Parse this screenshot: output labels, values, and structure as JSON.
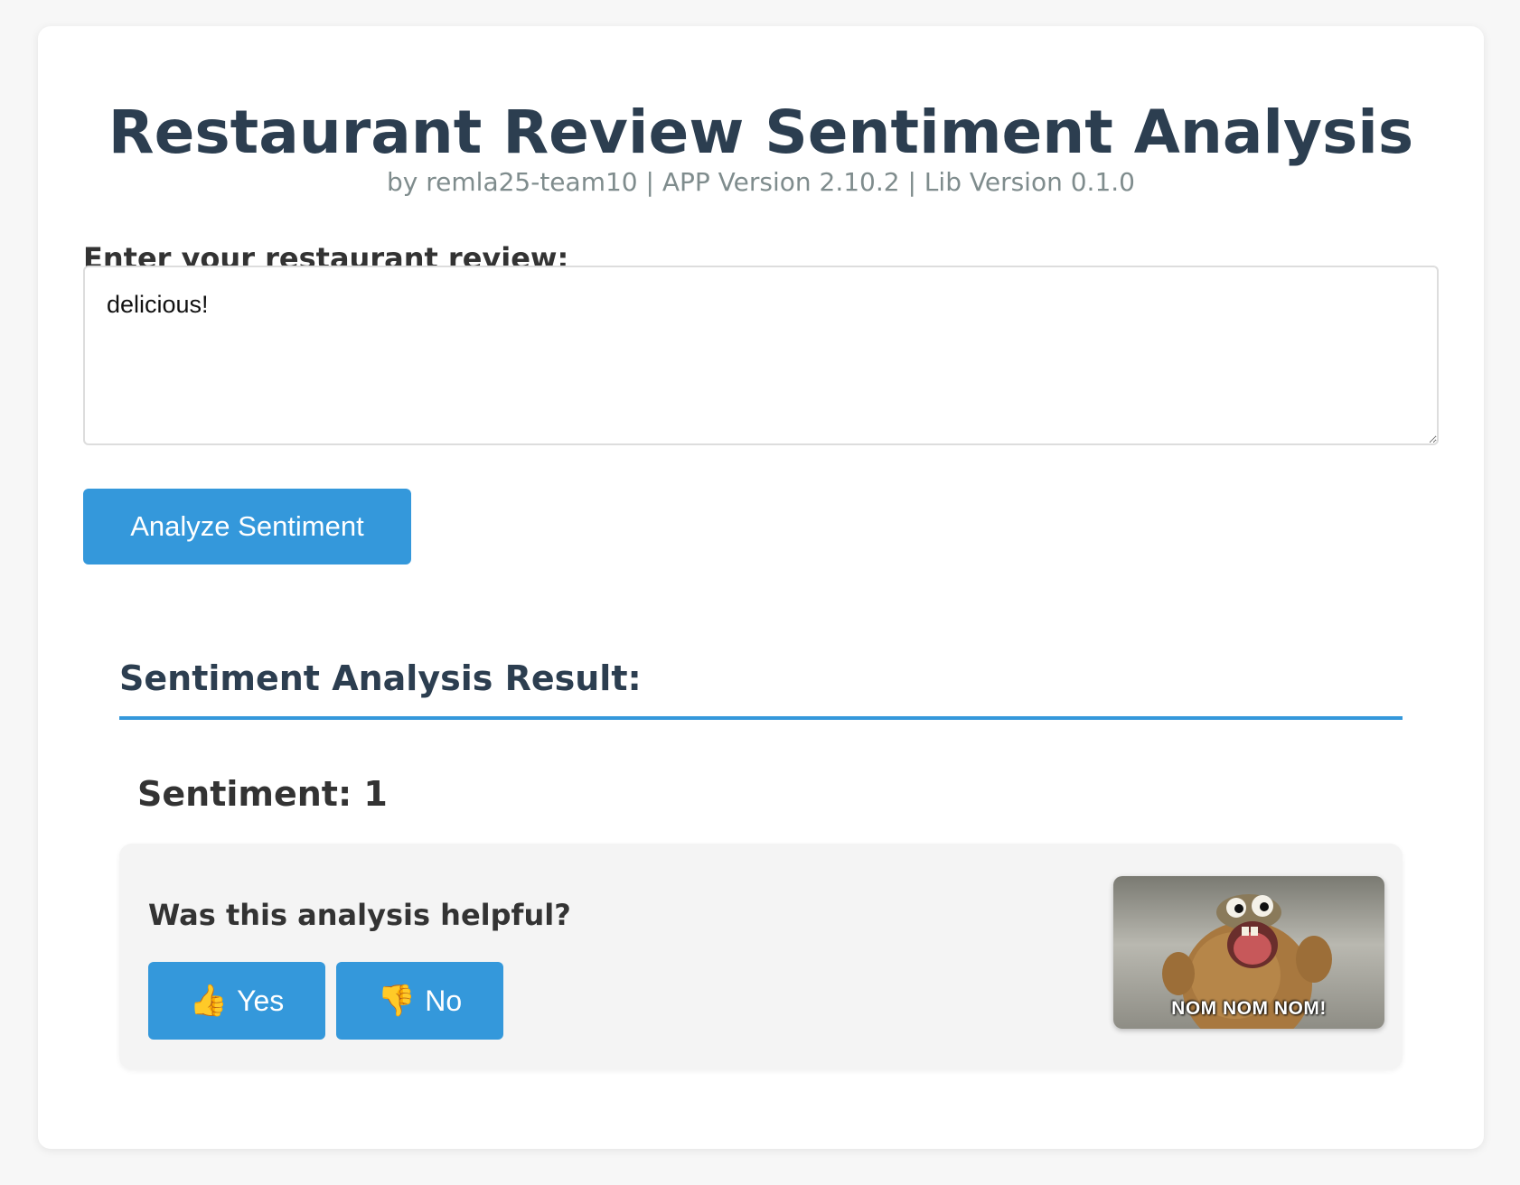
{
  "header": {
    "title": "Restaurant Review Sentiment Analysis",
    "subtitle": "by remla25-team10 | APP Version 2.10.2 | Lib Version 0.1.0"
  },
  "review_form": {
    "label": "Enter your restaurant review:",
    "value": "delicious!",
    "submit_label": "Analyze Sentiment"
  },
  "result": {
    "heading": "Sentiment Analysis Result:",
    "sentiment_text": "Sentiment: 1"
  },
  "feedback": {
    "question": "Was this analysis helpful?",
    "yes_icon": "👍",
    "yes_label": "Yes",
    "no_icon": "👎",
    "no_label": "No"
  },
  "gif": {
    "caption": "NOM NOM NOM!"
  },
  "colors": {
    "accent": "#3498db",
    "heading": "#2c3e50",
    "muted": "#7f8c8d"
  }
}
